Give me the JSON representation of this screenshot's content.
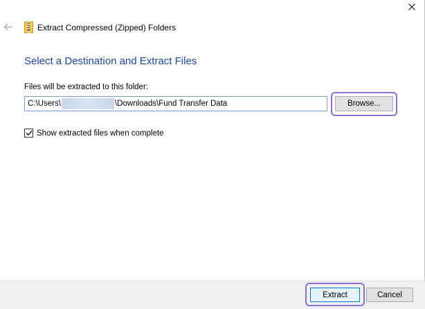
{
  "window": {
    "title": "Extract Compressed (Zipped) Folders"
  },
  "icons": {
    "close": "close-icon",
    "back": "back-arrow-icon",
    "title": "zip-folder-icon",
    "checkbox": "checkmark-icon"
  },
  "main": {
    "heading": "Select a Destination and Extract Files",
    "path_label": "Files will be extracted to this folder:",
    "path_prefix": "C:\\Users\\",
    "path_suffix": "\\Downloads\\Fund Transfer Data",
    "browse_label": "Browse...",
    "show_files_label": "Show extracted files when complete",
    "show_files_checked": true
  },
  "footer": {
    "extract_label": "Extract",
    "cancel_label": "Cancel"
  },
  "colors": {
    "heading": "#1a47a8",
    "highlight": "#8a6fd6",
    "primary_border": "#0078d7"
  }
}
